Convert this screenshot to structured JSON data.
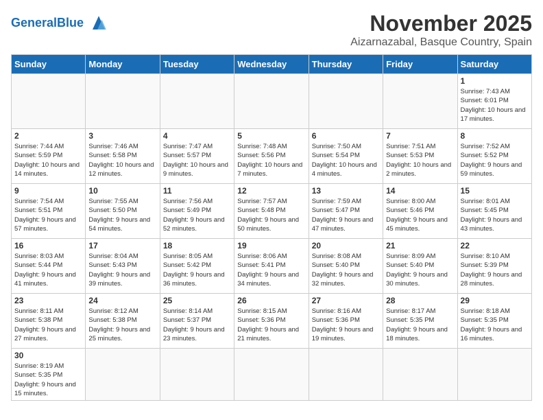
{
  "logo": {
    "text_general": "General",
    "text_blue": "Blue"
  },
  "header": {
    "month": "November 2025",
    "location": "Aizarnazabal, Basque Country, Spain"
  },
  "weekdays": [
    "Sunday",
    "Monday",
    "Tuesday",
    "Wednesday",
    "Thursday",
    "Friday",
    "Saturday"
  ],
  "weeks": [
    [
      {
        "day": "",
        "info": ""
      },
      {
        "day": "",
        "info": ""
      },
      {
        "day": "",
        "info": ""
      },
      {
        "day": "",
        "info": ""
      },
      {
        "day": "",
        "info": ""
      },
      {
        "day": "",
        "info": ""
      },
      {
        "day": "1",
        "info": "Sunrise: 7:43 AM\nSunset: 6:01 PM\nDaylight: 10 hours and 17 minutes."
      }
    ],
    [
      {
        "day": "2",
        "info": "Sunrise: 7:44 AM\nSunset: 5:59 PM\nDaylight: 10 hours and 14 minutes."
      },
      {
        "day": "3",
        "info": "Sunrise: 7:46 AM\nSunset: 5:58 PM\nDaylight: 10 hours and 12 minutes."
      },
      {
        "day": "4",
        "info": "Sunrise: 7:47 AM\nSunset: 5:57 PM\nDaylight: 10 hours and 9 minutes."
      },
      {
        "day": "5",
        "info": "Sunrise: 7:48 AM\nSunset: 5:56 PM\nDaylight: 10 hours and 7 minutes."
      },
      {
        "day": "6",
        "info": "Sunrise: 7:50 AM\nSunset: 5:54 PM\nDaylight: 10 hours and 4 minutes."
      },
      {
        "day": "7",
        "info": "Sunrise: 7:51 AM\nSunset: 5:53 PM\nDaylight: 10 hours and 2 minutes."
      },
      {
        "day": "8",
        "info": "Sunrise: 7:52 AM\nSunset: 5:52 PM\nDaylight: 9 hours and 59 minutes."
      }
    ],
    [
      {
        "day": "9",
        "info": "Sunrise: 7:54 AM\nSunset: 5:51 PM\nDaylight: 9 hours and 57 minutes."
      },
      {
        "day": "10",
        "info": "Sunrise: 7:55 AM\nSunset: 5:50 PM\nDaylight: 9 hours and 54 minutes."
      },
      {
        "day": "11",
        "info": "Sunrise: 7:56 AM\nSunset: 5:49 PM\nDaylight: 9 hours and 52 minutes."
      },
      {
        "day": "12",
        "info": "Sunrise: 7:57 AM\nSunset: 5:48 PM\nDaylight: 9 hours and 50 minutes."
      },
      {
        "day": "13",
        "info": "Sunrise: 7:59 AM\nSunset: 5:47 PM\nDaylight: 9 hours and 47 minutes."
      },
      {
        "day": "14",
        "info": "Sunrise: 8:00 AM\nSunset: 5:46 PM\nDaylight: 9 hours and 45 minutes."
      },
      {
        "day": "15",
        "info": "Sunrise: 8:01 AM\nSunset: 5:45 PM\nDaylight: 9 hours and 43 minutes."
      }
    ],
    [
      {
        "day": "16",
        "info": "Sunrise: 8:03 AM\nSunset: 5:44 PM\nDaylight: 9 hours and 41 minutes."
      },
      {
        "day": "17",
        "info": "Sunrise: 8:04 AM\nSunset: 5:43 PM\nDaylight: 9 hours and 39 minutes."
      },
      {
        "day": "18",
        "info": "Sunrise: 8:05 AM\nSunset: 5:42 PM\nDaylight: 9 hours and 36 minutes."
      },
      {
        "day": "19",
        "info": "Sunrise: 8:06 AM\nSunset: 5:41 PM\nDaylight: 9 hours and 34 minutes."
      },
      {
        "day": "20",
        "info": "Sunrise: 8:08 AM\nSunset: 5:40 PM\nDaylight: 9 hours and 32 minutes."
      },
      {
        "day": "21",
        "info": "Sunrise: 8:09 AM\nSunset: 5:40 PM\nDaylight: 9 hours and 30 minutes."
      },
      {
        "day": "22",
        "info": "Sunrise: 8:10 AM\nSunset: 5:39 PM\nDaylight: 9 hours and 28 minutes."
      }
    ],
    [
      {
        "day": "23",
        "info": "Sunrise: 8:11 AM\nSunset: 5:38 PM\nDaylight: 9 hours and 27 minutes."
      },
      {
        "day": "24",
        "info": "Sunrise: 8:12 AM\nSunset: 5:38 PM\nDaylight: 9 hours and 25 minutes."
      },
      {
        "day": "25",
        "info": "Sunrise: 8:14 AM\nSunset: 5:37 PM\nDaylight: 9 hours and 23 minutes."
      },
      {
        "day": "26",
        "info": "Sunrise: 8:15 AM\nSunset: 5:36 PM\nDaylight: 9 hours and 21 minutes."
      },
      {
        "day": "27",
        "info": "Sunrise: 8:16 AM\nSunset: 5:36 PM\nDaylight: 9 hours and 19 minutes."
      },
      {
        "day": "28",
        "info": "Sunrise: 8:17 AM\nSunset: 5:35 PM\nDaylight: 9 hours and 18 minutes."
      },
      {
        "day": "29",
        "info": "Sunrise: 8:18 AM\nSunset: 5:35 PM\nDaylight: 9 hours and 16 minutes."
      }
    ],
    [
      {
        "day": "30",
        "info": "Sunrise: 8:19 AM\nSunset: 5:35 PM\nDaylight: 9 hours and 15 minutes."
      },
      {
        "day": "",
        "info": ""
      },
      {
        "day": "",
        "info": ""
      },
      {
        "day": "",
        "info": ""
      },
      {
        "day": "",
        "info": ""
      },
      {
        "day": "",
        "info": ""
      },
      {
        "day": "",
        "info": ""
      }
    ]
  ]
}
